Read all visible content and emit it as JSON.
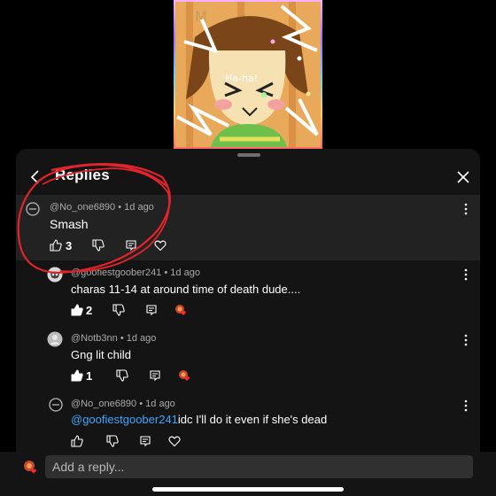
{
  "video": {
    "caption": "Ha-ha!",
    "watermark": "M"
  },
  "panel": {
    "title": "Replies"
  },
  "comments": [
    {
      "handle": "@No_one6890",
      "time": "1d ago",
      "text": "Smash",
      "likes": "3"
    },
    {
      "handle": "@goofiestgoober241",
      "time": "1d ago",
      "text": "charas 11-14 at around time of death dude....",
      "likes": "2"
    },
    {
      "handle": "@Notb3nn",
      "time": "1d ago",
      "text": "Gng lit child",
      "likes": "1"
    },
    {
      "handle": "@No_one6890",
      "time": "1d ago",
      "mention": "@goofiestgoober241",
      "text": "idc I'll do it even if she's dead",
      "likes": ""
    }
  ],
  "separator": "•",
  "reply": {
    "placeholder": "Add a reply..."
  },
  "colors": {
    "accent": "#3ea6ff",
    "annotation": "#e0242b",
    "highlight_row": "#222222"
  }
}
